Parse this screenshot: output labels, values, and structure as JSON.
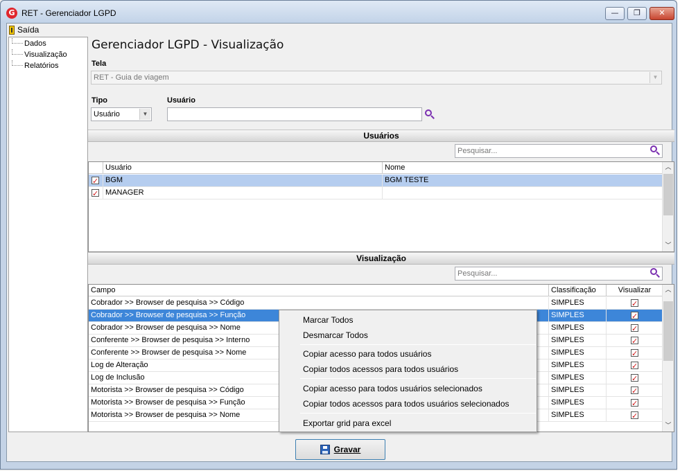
{
  "window": {
    "title": "RET - Gerenciador LGPD",
    "logo_letter": "G",
    "min_glyph": "—",
    "max_glyph": "❐",
    "close_glyph": "✕"
  },
  "menu": {
    "exit_label": "Saída"
  },
  "tree": {
    "items": [
      {
        "label": "Dados"
      },
      {
        "label": "Visualização"
      },
      {
        "label": "Relatórios"
      }
    ]
  },
  "page": {
    "title": "Gerenciador LGPD - Visualização"
  },
  "form": {
    "tela_label": "Tela",
    "tela_value": "RET - Guia de viagem",
    "tipo_label": "Tipo",
    "tipo_value": "Usuário",
    "usuario_label": "Usuário",
    "usuario_value": ""
  },
  "usuarios_section": {
    "title": "Usuários",
    "search_placeholder": "Pesquisar...",
    "columns": [
      "Usuário",
      "Nome"
    ],
    "rows": [
      {
        "checked": true,
        "usuario": "BGM",
        "nome": "BGM TESTE",
        "selected": true
      },
      {
        "checked": true,
        "usuario": "MANAGER",
        "nome": "",
        "selected": false
      }
    ]
  },
  "visualizacao_section": {
    "title": "Visualização",
    "search_placeholder": "Pesquisar...",
    "columns": [
      "Campo",
      "Classificação",
      "Visualizar"
    ],
    "rows": [
      {
        "campo": "Cobrador >> Browser de pesquisa >> Código",
        "classificacao": "SIMPLES",
        "visualizar": true
      },
      {
        "campo": "Cobrador >> Browser de pesquisa >> Função",
        "classificacao": "SIMPLES",
        "visualizar": true
      },
      {
        "campo": "Cobrador >> Browser de pesquisa >> Nome",
        "classificacao": "SIMPLES",
        "visualizar": true
      },
      {
        "campo": "Conferente >> Browser de pesquisa >> Interno",
        "classificacao": "SIMPLES",
        "visualizar": true
      },
      {
        "campo": "Conferente >> Browser de pesquisa >> Nome",
        "classificacao": "SIMPLES",
        "visualizar": true
      },
      {
        "campo": "Log de Alteração",
        "classificacao": "SIMPLES",
        "visualizar": true
      },
      {
        "campo": "Log de Inclusão",
        "classificacao": "SIMPLES",
        "visualizar": true
      },
      {
        "campo": "Motorista >> Browser de pesquisa >> Código",
        "classificacao": "SIMPLES",
        "visualizar": true
      },
      {
        "campo": "Motorista >> Browser de pesquisa >> Função",
        "classificacao": "SIMPLES",
        "visualizar": true
      },
      {
        "campo": "Motorista >> Browser de pesquisa >> Nome",
        "classificacao": "SIMPLES",
        "visualizar": true
      }
    ],
    "selected_row_index": 1
  },
  "context_menu": {
    "groups": [
      [
        "Marcar Todos",
        "Desmarcar Todos"
      ],
      [
        "Copiar acesso para todos usuários",
        "Copiar todos acessos para todos usuários"
      ],
      [
        "Copiar acesso para todos usuários selecionados",
        "Copiar todos acessos para todos usuários selecionados"
      ],
      [
        "Exportar grid para excel"
      ]
    ]
  },
  "buttons": {
    "gravar_label": "Gravar"
  },
  "colors": {
    "selection": "#3d86d9",
    "selection_light": "#b5cdef",
    "check_mark": "#d01818",
    "search_icon": "#7a2fb0"
  },
  "icons": {
    "search": "magnifier-icon",
    "save": "floppy-icon",
    "exit": "door-exit-icon"
  }
}
